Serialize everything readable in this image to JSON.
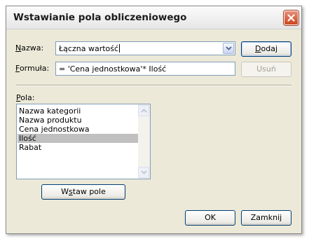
{
  "dialog": {
    "title": "Wstawianie pola obliczeniowego",
    "close_icon": "close-icon"
  },
  "name_row": {
    "label_accel": "N",
    "label_rest": "azwa:",
    "value": "Łączna wartość"
  },
  "formula_row": {
    "label_accel": "F",
    "label_rest": "ormuła:",
    "value": "= 'Cena jednostkowa'* Ilość"
  },
  "buttons": {
    "add_accel": "D",
    "add_rest": "odaj",
    "delete": "Usuń",
    "insert_field_pre": "W",
    "insert_field_accel": "s",
    "insert_field_post": "taw pole",
    "ok": "OK",
    "close": "Zamknij"
  },
  "fields": {
    "label_accel": "P",
    "label_rest": "ola:",
    "items": [
      "Nazwa kategorii",
      "Nazwa produktu",
      "Cena jednostkowa",
      "Ilość",
      "Rabat"
    ],
    "selected_index": 3
  },
  "colors": {
    "dialog_bg": "#ece9d8",
    "selection": "#c0c0c0",
    "input_border": "#7f9db9"
  }
}
